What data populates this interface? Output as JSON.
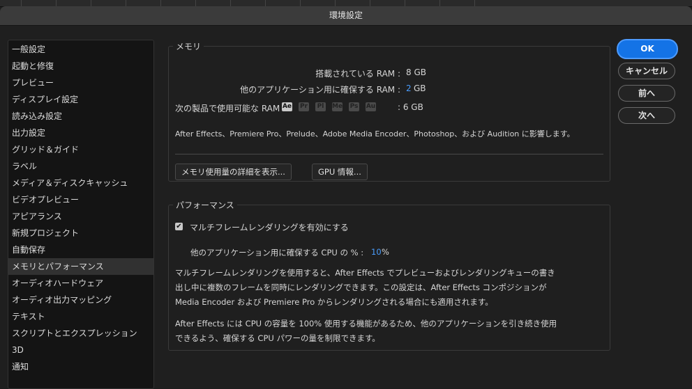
{
  "window": {
    "title": "環境設定"
  },
  "sidebar": {
    "items": [
      {
        "label": "一般設定",
        "name": "sidebar-item-general"
      },
      {
        "label": "起動と修復",
        "name": "sidebar-item-startup-repair"
      },
      {
        "label": "プレビュー",
        "name": "sidebar-item-previews"
      },
      {
        "label": "ディスプレイ設定",
        "name": "sidebar-item-display"
      },
      {
        "label": "読み込み設定",
        "name": "sidebar-item-import"
      },
      {
        "label": "出力設定",
        "name": "sidebar-item-output"
      },
      {
        "label": "グリッド＆ガイド",
        "name": "sidebar-item-grids-guides"
      },
      {
        "label": "ラベル",
        "name": "sidebar-item-labels"
      },
      {
        "label": "メディア＆ディスクキャッシュ",
        "name": "sidebar-item-media-cache"
      },
      {
        "label": "ビデオプレビュー",
        "name": "sidebar-item-video-preview"
      },
      {
        "label": "アピアランス",
        "name": "sidebar-item-appearance"
      },
      {
        "label": "新規プロジェクト",
        "name": "sidebar-item-new-project"
      },
      {
        "label": "自動保存",
        "name": "sidebar-item-auto-save"
      },
      {
        "label": "メモリとパフォーマンス",
        "name": "sidebar-item-memory-performance",
        "selected": true
      },
      {
        "label": "オーディオハードウェア",
        "name": "sidebar-item-audio-hardware"
      },
      {
        "label": "オーディオ出力マッピング",
        "name": "sidebar-item-audio-output-mapping"
      },
      {
        "label": "テキスト",
        "name": "sidebar-item-text"
      },
      {
        "label": "スクリプトとエクスプレッション",
        "name": "sidebar-item-scripting"
      },
      {
        "label": "3D",
        "name": "sidebar-item-3d"
      },
      {
        "label": "通知",
        "name": "sidebar-item-notifications"
      }
    ]
  },
  "memory": {
    "title": "メモリ",
    "installed_label": "搭載されている RAM :",
    "installed_value": "8 GB",
    "reserve_label": "他のアプリケーション用に確保する RAM :",
    "reserve_value": "2",
    "reserve_unit": "GB",
    "available_label": "次の製品で使用可能な RAM",
    "apps": [
      "Ae",
      "Pr",
      "Pl",
      "Me",
      "Ps",
      "Au"
    ],
    "available_value": ": 6 GB",
    "shared_note": "After Effects、Premiere Pro、Prelude、Adobe Media Encoder、Photoshop、および Audition に影響します。",
    "details_button": "メモリ使用量の詳細を表示...",
    "gpu_button": "GPU 情報..."
  },
  "performance": {
    "title": "パフォーマンス",
    "mfr_checkbox_label": "マルチフレームレンダリングを有効にする",
    "mfr_checked": true,
    "cpu_label": "他のアプリケーション用に確保する CPU の % :",
    "cpu_value": "10",
    "cpu_unit": "%",
    "para1_lines": [
      "マルチフレームレンダリングを使用すると、After Effects でプレビューおよびレンダリングキューの書き",
      "出し中に複数のフレームを同時にレンダリングできます。この設定は、After Effects コンポジションが",
      "Media Encoder および Premiere Pro からレンダリングされる場合にも適用されます。"
    ],
    "para2_lines": [
      "After Effects には CPU の容量を 100% 使用する機能があるため、他のアプリケーションを引き続き使用",
      "できるよう、確保する CPU パワーの量を制限できます。"
    ]
  },
  "buttons": {
    "ok": "OK",
    "cancel": "キャンセル",
    "prev": "前へ",
    "next": "次へ"
  },
  "colors": {
    "accent": "#1473e6",
    "value_blue": "#4a9eff",
    "background": "#1f1f1f"
  }
}
